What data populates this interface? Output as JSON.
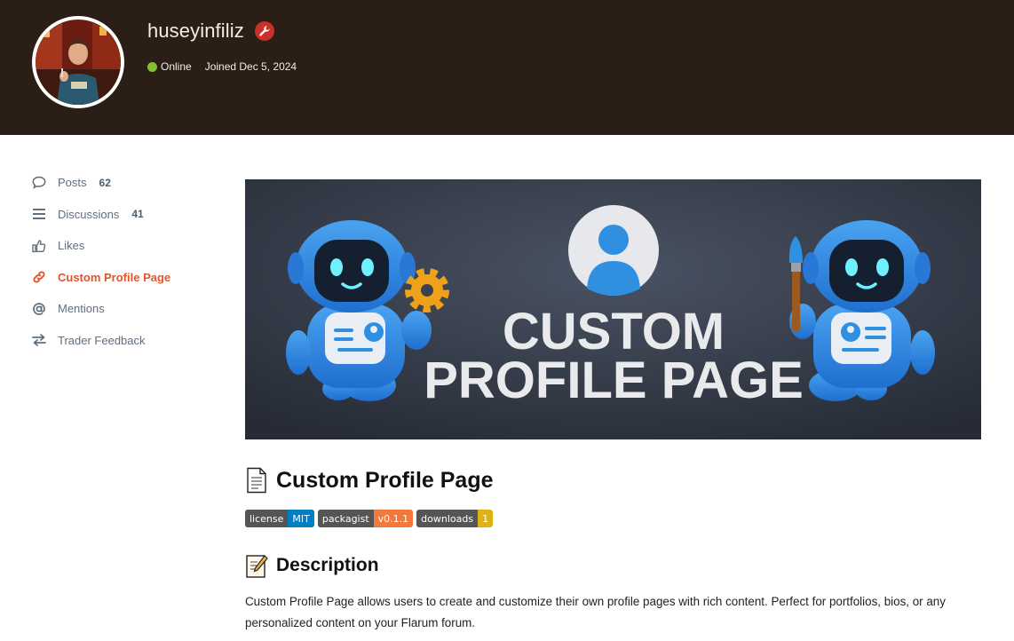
{
  "profile": {
    "username": "huseyinfiliz",
    "status": "Online",
    "joined": "Joined Dec 5, 2024"
  },
  "colors": {
    "header_bg": "#2a1e16",
    "accent": "#e0552b",
    "online": "#7ec233",
    "admin_badge": "#c9302c",
    "nav_text": "#5f6e80"
  },
  "sidebar": {
    "items": [
      {
        "label": "Posts",
        "count": "62",
        "icon": "comment-icon",
        "active": false
      },
      {
        "label": "Discussions",
        "count": "41",
        "icon": "bars-icon",
        "active": false
      },
      {
        "label": "Likes",
        "icon": "thumbs-up-icon",
        "active": false
      },
      {
        "label": "Custom Profile Page",
        "icon": "link-icon",
        "active": true
      },
      {
        "label": "Mentions",
        "icon": "at-icon",
        "active": false
      },
      {
        "label": "Trader Feedback",
        "icon": "exchange-icon",
        "active": false
      }
    ]
  },
  "banner": {
    "line1": "CUSTOM",
    "line2": "PROFILE PAGE"
  },
  "content": {
    "title": "Custom Profile Page",
    "title_icon": "page-icon",
    "badges": [
      {
        "label": "license",
        "value": "MIT",
        "color": "#007ec6"
      },
      {
        "label": "packagist",
        "value": "v0.1.1",
        "color": "#f0793b"
      },
      {
        "label": "downloads",
        "value": "1",
        "color": "#dfb317"
      }
    ],
    "description_heading": "Description",
    "description_icon": "memo-icon",
    "description": "Custom Profile Page allows users to create and customize their own profile pages with rich content. Perfect for portfolios, bios, or any personalized content on your Flarum forum."
  }
}
